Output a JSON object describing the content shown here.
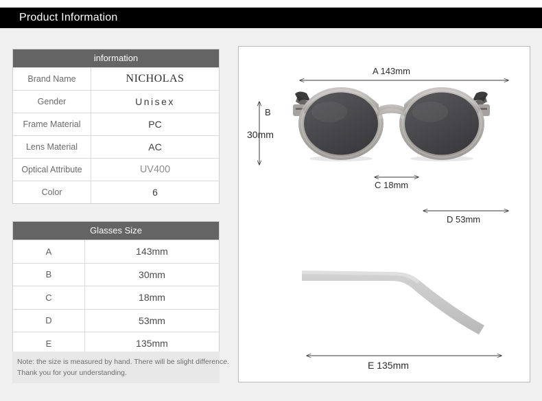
{
  "header": {
    "title": "Product Information"
  },
  "info_table": {
    "heading": "information",
    "rows": [
      {
        "key": "Brand Name",
        "value": "NICHOLAS"
      },
      {
        "key": "Gender",
        "value": "Unisex"
      },
      {
        "key": "Frame Material",
        "value": "PC"
      },
      {
        "key": "Lens Material",
        "value": "AC"
      },
      {
        "key": "Optical Attribute",
        "value": "UV400"
      },
      {
        "key": "Color",
        "value": "6"
      }
    ]
  },
  "size_table": {
    "heading": "Glasses Size",
    "rows": [
      {
        "key": "A",
        "value": "143mm"
      },
      {
        "key": "B",
        "value": "30mm"
      },
      {
        "key": "C",
        "value": "18mm"
      },
      {
        "key": "D",
        "value": "53mm"
      },
      {
        "key": "E",
        "value": "135mm"
      }
    ]
  },
  "note": {
    "line1": "Note: the size is measured by hand. There will be slight difference.",
    "line2": "Thank you for your understanding."
  },
  "diagram": {
    "front_view": {
      "a_label": "A   143mm",
      "b_label": "B",
      "b_value": "30mm",
      "c_label": "C  18mm",
      "d_label": "D  53mm"
    },
    "side_view": {
      "e_label": "E  135mm"
    }
  },
  "colors": {
    "header_bar": "#000000",
    "page_background": "#f0f0f0",
    "table_header": "#646464",
    "note_background": "#e8e8e8",
    "frame_gray": "#b9b7b4",
    "lens_dark": "#4a4a4c",
    "temple_gray": "#c9c9c9",
    "arrow": "#3a3a3a"
  }
}
